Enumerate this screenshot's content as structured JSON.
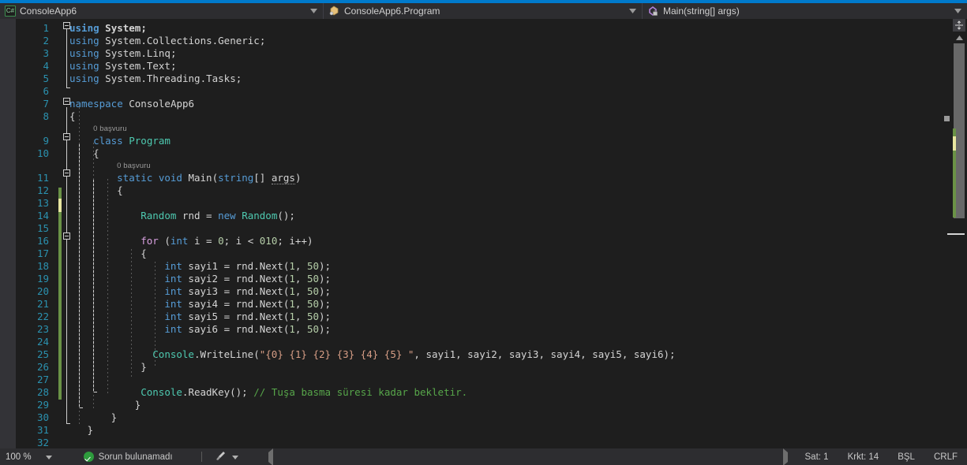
{
  "colors": {
    "accent": "#007acc",
    "editor_bg": "#1e1e1e",
    "chrome_bg": "#2d2d30",
    "linenumber": "#2b91af",
    "keyword": "#569cd6",
    "type": "#4ec9b0",
    "string": "#d69d85",
    "number": "#b5cea8",
    "comment": "#57a64a",
    "control_keyword": "#d8a0df",
    "change_bar": "#6a9246",
    "change_bar_pending": "#e8e6a0",
    "ok_green": "#2e9c3d"
  },
  "navbar": {
    "project": {
      "label": "ConsoleApp6",
      "icon": "csharp-project-icon",
      "dropdown": "chevron-down-icon"
    },
    "type": {
      "label": "ConsoleApp6.Program",
      "icon": "class-icon",
      "dropdown": "chevron-down-icon"
    },
    "member": {
      "label": "Main(string[] args)",
      "icon": "method-icon",
      "dropdown": "chevron-down-icon"
    }
  },
  "editor": {
    "lines": [
      {
        "n": "1",
        "indent": 0,
        "tokens": [
          {
            "t": "using",
            "c": "kw bold"
          },
          {
            "t": " ",
            "c": "punc"
          },
          {
            "t": "System",
            "c": "ns bold"
          },
          {
            "t": ";",
            "c": "punc bold"
          }
        ]
      },
      {
        "n": "2",
        "indent": 0,
        "tokens": [
          {
            "t": "using",
            "c": "kw"
          },
          {
            "t": " System.Collections.Generic;",
            "c": "ns"
          }
        ]
      },
      {
        "n": "3",
        "indent": 0,
        "tokens": [
          {
            "t": "using",
            "c": "kw"
          },
          {
            "t": " System.Linq;",
            "c": "ns"
          }
        ]
      },
      {
        "n": "4",
        "indent": 0,
        "tokens": [
          {
            "t": "using",
            "c": "kw"
          },
          {
            "t": " System.Text;",
            "c": "ns"
          }
        ]
      },
      {
        "n": "5",
        "indent": 0,
        "tokens": [
          {
            "t": "using",
            "c": "kw"
          },
          {
            "t": " System.Threading.Tasks;",
            "c": "ns"
          }
        ]
      },
      {
        "n": "6",
        "indent": 0,
        "tokens": []
      },
      {
        "n": "7",
        "indent": 0,
        "tokens": [
          {
            "t": "namespace",
            "c": "kw"
          },
          {
            "t": " ConsoleApp6",
            "c": "ns"
          }
        ]
      },
      {
        "n": "8",
        "indent": 0,
        "tokens": [
          {
            "t": "{",
            "c": "punc"
          }
        ]
      },
      {
        "n": "",
        "indent": 0,
        "codelens": "0 başvuru",
        "lens_indent": 4
      },
      {
        "n": "9",
        "indent": 4,
        "tokens": [
          {
            "t": "class",
            "c": "kw"
          },
          {
            "t": " ",
            "c": "punc"
          },
          {
            "t": "Program",
            "c": "typ"
          }
        ]
      },
      {
        "n": "10",
        "indent": 4,
        "tokens": [
          {
            "t": "{",
            "c": "punc"
          }
        ]
      },
      {
        "n": "",
        "indent": 0,
        "codelens": "0 başvuru",
        "lens_indent": 8
      },
      {
        "n": "11",
        "indent": 8,
        "tokens": [
          {
            "t": "static",
            "c": "kw"
          },
          {
            "t": " ",
            "c": "punc"
          },
          {
            "t": "void",
            "c": "kw"
          },
          {
            "t": " ",
            "c": "punc"
          },
          {
            "t": "Main",
            "c": "id"
          },
          {
            "t": "(",
            "c": "punc"
          },
          {
            "t": "string",
            "c": "kw"
          },
          {
            "t": "[] ",
            "c": "punc"
          },
          {
            "t": "args",
            "c": "id arg-sq"
          },
          {
            "t": ")",
            "c": "punc"
          }
        ]
      },
      {
        "n": "12",
        "indent": 8,
        "tokens": [
          {
            "t": "{",
            "c": "punc"
          }
        ]
      },
      {
        "n": "13",
        "indent": 0,
        "tokens": []
      },
      {
        "n": "14",
        "indent": 12,
        "tokens": [
          {
            "t": "Random",
            "c": "typ"
          },
          {
            "t": " rnd = ",
            "c": "id"
          },
          {
            "t": "new",
            "c": "kw"
          },
          {
            "t": " ",
            "c": "punc"
          },
          {
            "t": "Random",
            "c": "typ"
          },
          {
            "t": "();",
            "c": "punc"
          }
        ]
      },
      {
        "n": "15",
        "indent": 0,
        "tokens": []
      },
      {
        "n": "16",
        "indent": 12,
        "tokens": [
          {
            "t": "for",
            "c": "ctl"
          },
          {
            "t": " (",
            "c": "punc"
          },
          {
            "t": "int",
            "c": "kw"
          },
          {
            "t": " i = ",
            "c": "id"
          },
          {
            "t": "0",
            "c": "num"
          },
          {
            "t": "; i < ",
            "c": "id"
          },
          {
            "t": "010",
            "c": "num"
          },
          {
            "t": "; i++)",
            "c": "id"
          }
        ]
      },
      {
        "n": "17",
        "indent": 12,
        "tokens": [
          {
            "t": "{",
            "c": "punc"
          }
        ]
      },
      {
        "n": "18",
        "indent": 16,
        "tokens": [
          {
            "t": "int",
            "c": "kw"
          },
          {
            "t": " sayi1 = rnd.Next(",
            "c": "id"
          },
          {
            "t": "1",
            "c": "num"
          },
          {
            "t": ", ",
            "c": "id"
          },
          {
            "t": "50",
            "c": "num"
          },
          {
            "t": ");",
            "c": "punc"
          }
        ]
      },
      {
        "n": "19",
        "indent": 16,
        "tokens": [
          {
            "t": "int",
            "c": "kw"
          },
          {
            "t": " sayi2 = rnd.Next(",
            "c": "id"
          },
          {
            "t": "1",
            "c": "num"
          },
          {
            "t": ", ",
            "c": "id"
          },
          {
            "t": "50",
            "c": "num"
          },
          {
            "t": ");",
            "c": "punc"
          }
        ]
      },
      {
        "n": "20",
        "indent": 16,
        "tokens": [
          {
            "t": "int",
            "c": "kw"
          },
          {
            "t": " sayi3 = rnd.Next(",
            "c": "id"
          },
          {
            "t": "1",
            "c": "num"
          },
          {
            "t": ", ",
            "c": "id"
          },
          {
            "t": "50",
            "c": "num"
          },
          {
            "t": ");",
            "c": "punc"
          }
        ]
      },
      {
        "n": "21",
        "indent": 16,
        "tokens": [
          {
            "t": "int",
            "c": "kw"
          },
          {
            "t": " sayi4 = rnd.Next(",
            "c": "id"
          },
          {
            "t": "1",
            "c": "num"
          },
          {
            "t": ", ",
            "c": "id"
          },
          {
            "t": "50",
            "c": "num"
          },
          {
            "t": ");",
            "c": "punc"
          }
        ]
      },
      {
        "n": "22",
        "indent": 16,
        "tokens": [
          {
            "t": "int",
            "c": "kw"
          },
          {
            "t": " sayi5 = rnd.Next(",
            "c": "id"
          },
          {
            "t": "1",
            "c": "num"
          },
          {
            "t": ", ",
            "c": "id"
          },
          {
            "t": "50",
            "c": "num"
          },
          {
            "t": ");",
            "c": "punc"
          }
        ]
      },
      {
        "n": "23",
        "indent": 16,
        "tokens": [
          {
            "t": "int",
            "c": "kw"
          },
          {
            "t": " sayi6 = rnd.Next(",
            "c": "id"
          },
          {
            "t": "1",
            "c": "num"
          },
          {
            "t": ", ",
            "c": "id"
          },
          {
            "t": "50",
            "c": "num"
          },
          {
            "t": ");",
            "c": "punc"
          }
        ]
      },
      {
        "n": "24",
        "indent": 0,
        "tokens": []
      },
      {
        "n": "25",
        "indent": 14,
        "tokens": [
          {
            "t": "Console",
            "c": "typ"
          },
          {
            "t": ".WriteLine(",
            "c": "id"
          },
          {
            "t": "\"{0} {1} {2} {3} {4} {5} \"",
            "c": "str"
          },
          {
            "t": ", sayi1, sayi2, sayi3, sayi4, sayi5, sayi6);",
            "c": "id"
          }
        ]
      },
      {
        "n": "26",
        "indent": 12,
        "tokens": [
          {
            "t": "}",
            "c": "punc"
          }
        ]
      },
      {
        "n": "27",
        "indent": 0,
        "tokens": []
      },
      {
        "n": "28",
        "indent": 12,
        "tokens": [
          {
            "t": "Console",
            "c": "typ"
          },
          {
            "t": ".ReadKey();",
            "c": "id"
          },
          {
            "t": " ",
            "c": "punc"
          },
          {
            "t": "// Tuşa basma süresi kadar bekletir.",
            "c": "cmt"
          }
        ]
      },
      {
        "n": "29",
        "indent": 11,
        "tokens": [
          {
            "t": "}",
            "c": "punc"
          }
        ]
      },
      {
        "n": "30",
        "indent": 7,
        "tokens": [
          {
            "t": "}",
            "c": "punc"
          }
        ]
      },
      {
        "n": "31",
        "indent": 3,
        "tokens": [
          {
            "t": "}",
            "c": "punc"
          }
        ]
      },
      {
        "n": "32",
        "indent": 0,
        "tokens": []
      }
    ]
  },
  "scrollbar": {
    "split_view_icon": "split-view-icon",
    "scroll_up_icon": "chevron-up-icon"
  },
  "statusbar": {
    "zoom": "100 %",
    "zoom_dropdown": "chevron-down-icon",
    "issues_icon": "success-check-icon",
    "issues": "Sorun bulunamadı",
    "brush_icon": "brush-icon",
    "brush_dropdown": "chevron-down-icon",
    "prev_icon": "triangle-left-icon",
    "next_icon": "triangle-right-icon",
    "row": "Sat: 1",
    "col": "Krkt: 14",
    "insert_mode": "BŞL",
    "line_ending": "CRLF"
  }
}
